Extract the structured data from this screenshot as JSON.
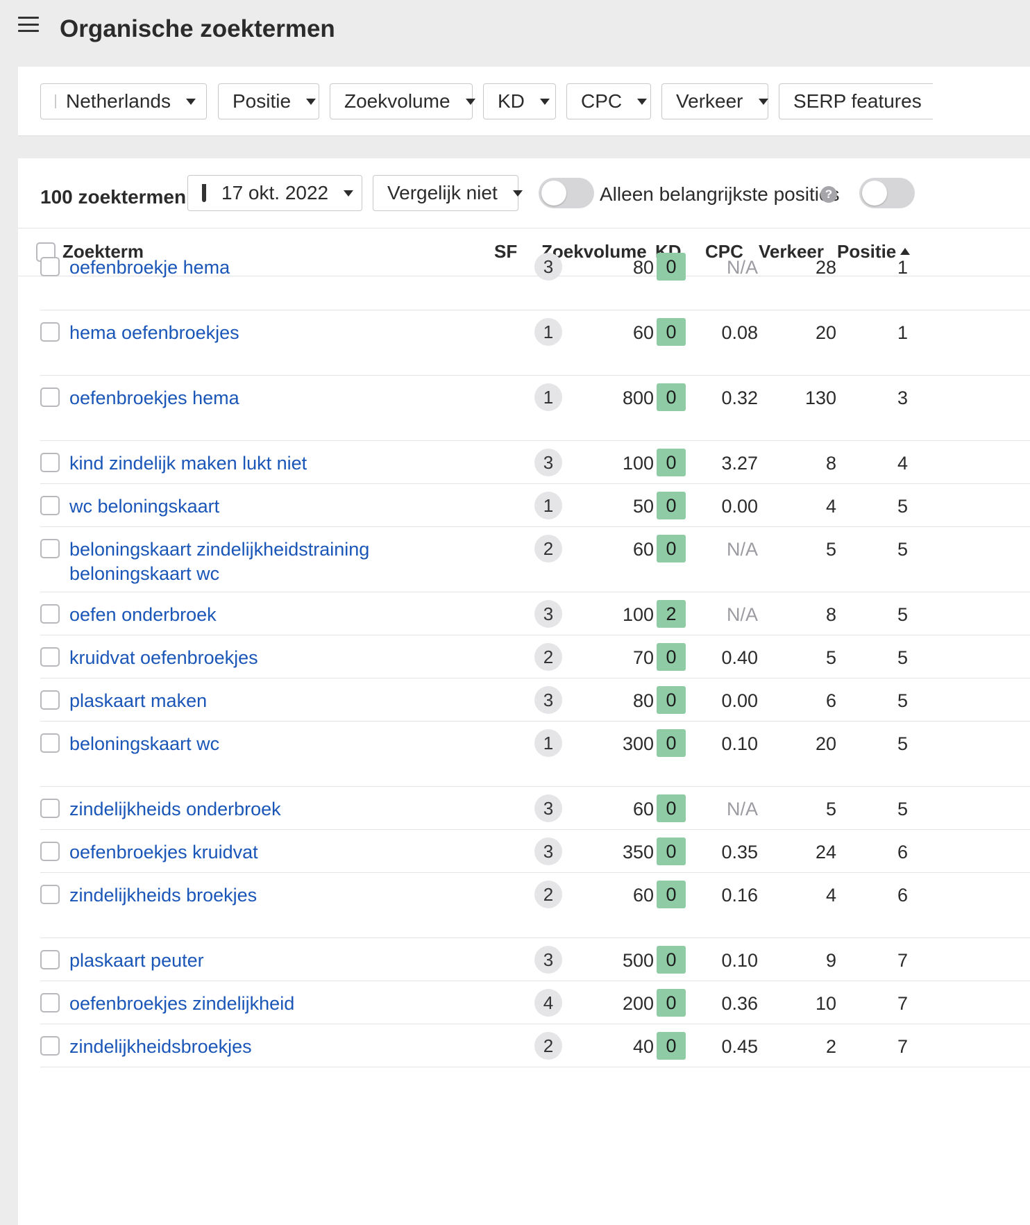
{
  "header": {
    "title": "Organische zoektermen"
  },
  "filters": {
    "country": "Netherlands",
    "position": "Positie",
    "volume": "Zoekvolume",
    "kd": "KD",
    "cpc": "CPC",
    "traffic": "Verkeer",
    "serp": "SERP features"
  },
  "flag_colors": [
    "#ae1c28",
    "#ffffff",
    "#21468b"
  ],
  "controls": {
    "count": "100 zoektermen",
    "date": "17 okt. 2022",
    "compare": "Vergelijk niet",
    "top_positions_label": "Alleen belangrijkste posities",
    "help": "?"
  },
  "table": {
    "headers": {
      "keyword": "Zoekterm",
      "sf": "SF",
      "volume": "Zoekvolume",
      "kd": "KD",
      "cpc": "CPC",
      "traffic": "Verkeer",
      "position": "Positie"
    },
    "rows": [
      {
        "keyword": "oefenbroekje hema",
        "sf": "3",
        "volume": "80",
        "kd": "0",
        "cpc": "N/A",
        "traffic": "28",
        "position": "1"
      },
      {
        "keyword": "hema oefenbroekjes",
        "sf": "1",
        "volume": "60",
        "kd": "0",
        "cpc": "0.08",
        "traffic": "20",
        "position": "1"
      },
      {
        "keyword": "oefenbroekjes hema",
        "sf": "1",
        "volume": "800",
        "kd": "0",
        "cpc": "0.32",
        "traffic": "130",
        "position": "3"
      },
      {
        "keyword": "kind zindelijk maken lukt niet",
        "sf": "3",
        "volume": "100",
        "kd": "0",
        "cpc": "3.27",
        "traffic": "8",
        "position": "4"
      },
      {
        "keyword": "wc beloningskaart",
        "sf": "1",
        "volume": "50",
        "kd": "0",
        "cpc": "0.00",
        "traffic": "4",
        "position": "5"
      },
      {
        "keyword": "beloningskaart zindelijkheidstraining beloningskaart wc",
        "sf": "2",
        "volume": "60",
        "kd": "0",
        "cpc": "N/A",
        "traffic": "5",
        "position": "5"
      },
      {
        "keyword": "oefen onderbroek",
        "sf": "3",
        "volume": "100",
        "kd": "2",
        "cpc": "N/A",
        "traffic": "8",
        "position": "5"
      },
      {
        "keyword": "kruidvat oefenbroekjes",
        "sf": "2",
        "volume": "70",
        "kd": "0",
        "cpc": "0.40",
        "traffic": "5",
        "position": "5"
      },
      {
        "keyword": "plaskaart maken",
        "sf": "3",
        "volume": "80",
        "kd": "0",
        "cpc": "0.00",
        "traffic": "6",
        "position": "5"
      },
      {
        "keyword": "beloningskaart wc",
        "sf": "1",
        "volume": "300",
        "kd": "0",
        "cpc": "0.10",
        "traffic": "20",
        "position": "5"
      },
      {
        "keyword": "zindelijkheids onderbroek",
        "sf": "3",
        "volume": "60",
        "kd": "0",
        "cpc": "N/A",
        "traffic": "5",
        "position": "5"
      },
      {
        "keyword": "oefenbroekjes kruidvat",
        "sf": "3",
        "volume": "350",
        "kd": "0",
        "cpc": "0.35",
        "traffic": "24",
        "position": "6"
      },
      {
        "keyword": "zindelijkheids broekjes",
        "sf": "2",
        "volume": "60",
        "kd": "0",
        "cpc": "0.16",
        "traffic": "4",
        "position": "6"
      },
      {
        "keyword": "plaskaart peuter",
        "sf": "3",
        "volume": "500",
        "kd": "0",
        "cpc": "0.10",
        "traffic": "9",
        "position": "7"
      },
      {
        "keyword": "oefenbroekjes zindelijkheid",
        "sf": "4",
        "volume": "200",
        "kd": "0",
        "cpc": "0.36",
        "traffic": "10",
        "position": "7"
      },
      {
        "keyword": "zindelijkheidsbroekjes",
        "sf": "2",
        "volume": "40",
        "kd": "0",
        "cpc": "0.45",
        "traffic": "2",
        "position": "7"
      }
    ]
  },
  "colors": {
    "link": "#1a56b8",
    "kd_badge": "#8fcba4",
    "na_text": "#9b9ba1"
  }
}
